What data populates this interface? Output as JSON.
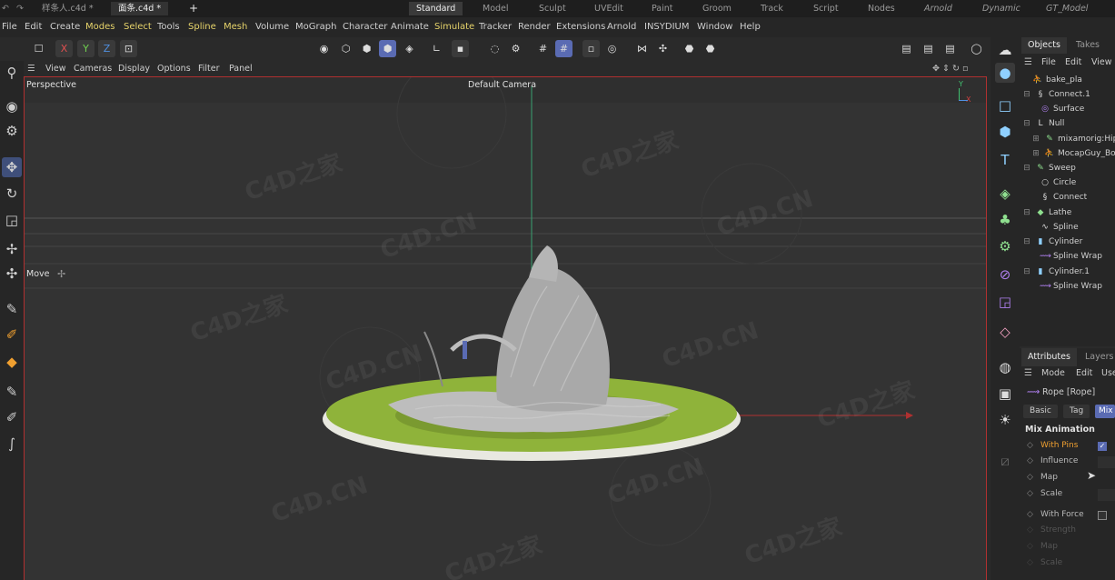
{
  "topbar": {
    "files": [
      "样条人.c4d *",
      "面条.c4d *"
    ],
    "add_tab": "+",
    "layouts": [
      "Standard",
      "Model",
      "Sculpt",
      "UVEdit",
      "Paint",
      "Groom",
      "Track",
      "Script",
      "Nodes",
      "Arnold",
      "Dynamic",
      "GT_Model"
    ],
    "active_layout": "Standard"
  },
  "menubar": [
    "File",
    "Edit",
    "Create",
    "Modes",
    "Select",
    "Tools",
    "Spline",
    "Mesh",
    "Volume",
    "MoGraph",
    "Character",
    "Animate",
    "Simulate",
    "Tracker",
    "Render",
    "Extensions",
    "Arnold",
    "INSYDIUM",
    "Window",
    "Help"
  ],
  "toolbar": {
    "x": "X",
    "y": "Y",
    "z": "Z"
  },
  "viewport_menu": [
    "View",
    "Cameras",
    "Display",
    "Options",
    "Filter",
    "Panel"
  ],
  "viewport": {
    "projection": "Perspective",
    "camera": "Default Camera",
    "tool_label": "Move",
    "axis_y": "Y",
    "axis_x": "X",
    "watermarks": [
      "C4D之家",
      "C4D.CN"
    ]
  },
  "objects_panel": {
    "tabs": [
      "Objects",
      "Takes"
    ],
    "menu": [
      "File",
      "Edit",
      "View"
    ],
    "items": [
      {
        "label": "bake_pla",
        "icon": "skeleton-icon"
      },
      {
        "label": "Connect.1",
        "icon": "connect-icon"
      },
      {
        "label": "Surface",
        "icon": "surface-icon"
      },
      {
        "label": "Null",
        "icon": "null-icon"
      },
      {
        "label": "mixamorig:Hips",
        "icon": "joint-icon"
      },
      {
        "label": "MocapGuy_Bod",
        "icon": "mesh-icon"
      },
      {
        "label": "Sweep",
        "icon": "sweep-icon"
      },
      {
        "label": "Circle",
        "icon": "circle-icon"
      },
      {
        "label": "Connect",
        "icon": "connect-icon"
      },
      {
        "label": "Lathe",
        "icon": "lathe-icon"
      },
      {
        "label": "Spline",
        "icon": "spline-icon"
      },
      {
        "label": "Cylinder",
        "icon": "cylinder-icon"
      },
      {
        "label": "Spline Wrap",
        "icon": "splinewrap-icon"
      },
      {
        "label": "Cylinder.1",
        "icon": "cylinder-icon"
      },
      {
        "label": "Spline Wrap",
        "icon": "splinewrap-icon"
      }
    ]
  },
  "attributes_panel": {
    "tabs": [
      "Attributes",
      "Layers"
    ],
    "menu": [
      "Mode",
      "Edit",
      "Use"
    ],
    "object_name": "Rope [Rope]",
    "subtabs": [
      "Basic",
      "Tag",
      "Mix"
    ],
    "section": "Mix Animation",
    "params": [
      "With Pins",
      "Influence",
      "Map",
      "Scale",
      "With Force",
      "Strength",
      "Map",
      "Scale"
    ],
    "with_pins_checked": true,
    "with_force_checked": false
  },
  "colors": {
    "accent": "#5a6bb3",
    "plate": "#8fb33a",
    "viewport_border": "#b03030",
    "highlight": "#e6d36a",
    "orange": "#f0a030"
  }
}
